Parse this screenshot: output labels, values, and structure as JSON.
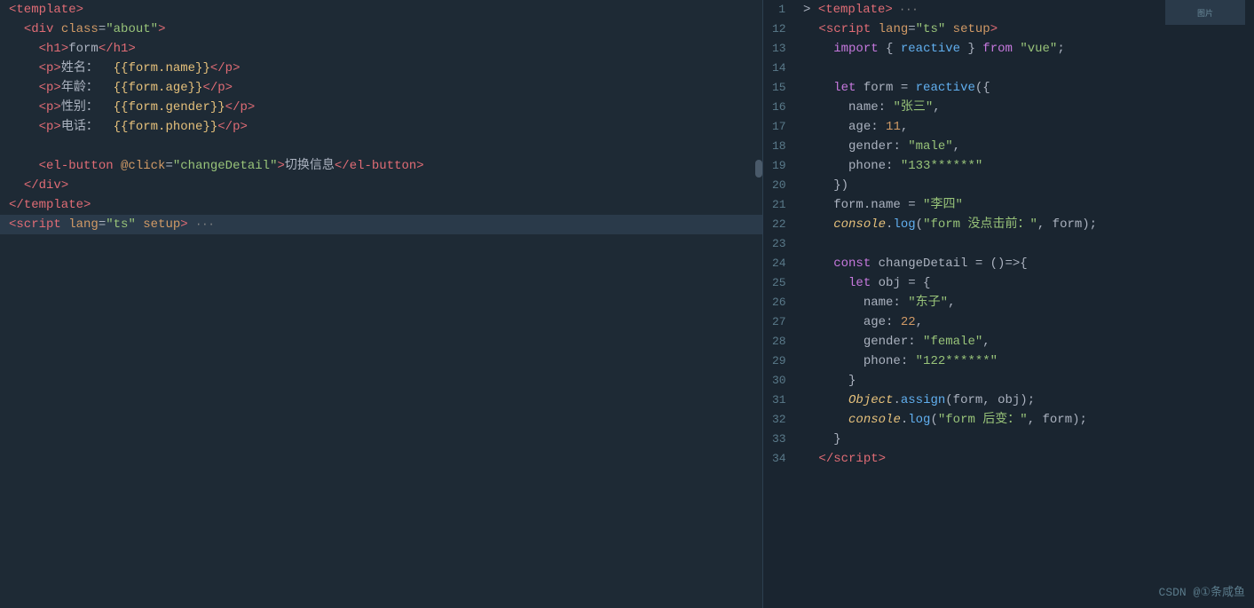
{
  "left": {
    "lines": [
      {
        "content": "<template>",
        "indent": 0,
        "type": "tag-line"
      },
      {
        "content": "  <div class=\"about\">",
        "indent": 0,
        "type": "tag-line"
      },
      {
        "content": "    <h1>form</h1>",
        "indent": 0,
        "type": "tag-line"
      },
      {
        "content": "    <p>姓名：  {{form.name}}</p>",
        "indent": 0,
        "type": "mixed"
      },
      {
        "content": "    <p>年龄：  {{form.age}}</p>",
        "indent": 0,
        "type": "mixed"
      },
      {
        "content": "    <p>性别：  {{form.gender}}</p>",
        "indent": 0,
        "type": "mixed"
      },
      {
        "content": "    <p>电话：  {{form.phone}}</p>",
        "indent": 0,
        "type": "mixed"
      },
      {
        "content": "",
        "indent": 0,
        "type": "empty"
      },
      {
        "content": "    <el-button @click=\"changeDetail\">切换信息</el-button>",
        "indent": 0,
        "type": "tag-line"
      },
      {
        "content": "  </div>",
        "indent": 0,
        "type": "tag-line"
      },
      {
        "content": "</template>",
        "indent": 0,
        "type": "tag-line"
      },
      {
        "content": "<script lang=\"ts\" setup> ···",
        "indent": 0,
        "type": "script-collapsed"
      }
    ]
  },
  "right": {
    "lines": [
      {
        "num": 1,
        "content_html": "collapsed_template"
      },
      {
        "num": 12,
        "content_html": "script_setup"
      },
      {
        "num": 13,
        "content_html": "import_reactive"
      },
      {
        "num": 14,
        "content_html": "empty"
      },
      {
        "num": 15,
        "content_html": "let_form_reactive"
      },
      {
        "num": 16,
        "content_html": "name_zhangsan"
      },
      {
        "num": 17,
        "content_html": "age_11"
      },
      {
        "num": 18,
        "content_html": "gender_male"
      },
      {
        "num": 19,
        "content_html": "phone_133"
      },
      {
        "num": 20,
        "content_html": "close_obj"
      },
      {
        "num": 21,
        "content_html": "form_name_lisi"
      },
      {
        "num": 22,
        "content_html": "console_log_before"
      },
      {
        "num": 23,
        "content_html": "empty"
      },
      {
        "num": 24,
        "content_html": "const_changeDetail"
      },
      {
        "num": 25,
        "content_html": "let_obj"
      },
      {
        "num": 26,
        "content_html": "name_dongzi"
      },
      {
        "num": 27,
        "content_html": "age_22"
      },
      {
        "num": 28,
        "content_html": "gender_female"
      },
      {
        "num": 29,
        "content_html": "phone_122"
      },
      {
        "num": 30,
        "content_html": "close_brace"
      },
      {
        "num": 31,
        "content_html": "object_assign"
      },
      {
        "num": 32,
        "content_html": "console_log_after"
      },
      {
        "num": 33,
        "content_html": "close_brace2"
      },
      {
        "num": 34,
        "content_html": "close_script"
      }
    ]
  },
  "watermark": "CSDN @①条咸鱼"
}
